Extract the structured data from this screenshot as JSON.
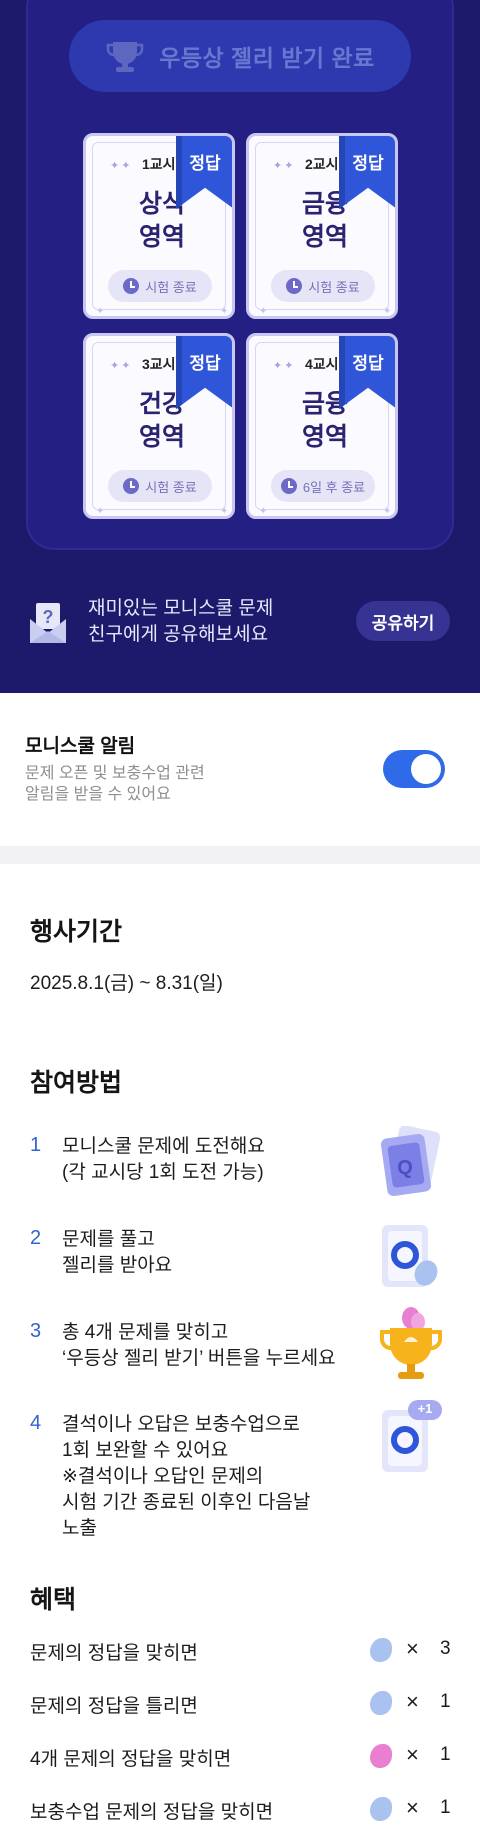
{
  "award_button": {
    "label": "우등상 젤리 받기 완료",
    "icon": "trophy-icon"
  },
  "cards": [
    {
      "period": "1교시",
      "subject_line1": "상식",
      "subject_line2": "영역",
      "badge": "정답",
      "status": "시험 종료"
    },
    {
      "period": "2교시",
      "subject_line1": "금융",
      "subject_line2": "영역",
      "badge": "정답",
      "status": "시험 종료"
    },
    {
      "period": "3교시",
      "subject_line1": "건강",
      "subject_line2": "영역",
      "badge": "정답",
      "status": "시험 종료"
    },
    {
      "period": "4교시",
      "subject_line1": "금융",
      "subject_line2": "영역",
      "badge": "정답",
      "status": "6일 후 종료"
    }
  ],
  "share": {
    "line1": "재미있는 모니스쿨 문제",
    "line2": "친구에게 공유해보세요",
    "button": "공유하기"
  },
  "notification": {
    "title": "모니스쿨 알림",
    "desc_line1": "문제 오픈 및 보충수업 관련",
    "desc_line2": "알림을 받을 수 있어요",
    "toggle_on": true
  },
  "event_period": {
    "title": "행사기간",
    "value": "2025.8.1(금) ~ 8.31(일)"
  },
  "how_to": {
    "title": "참여방법",
    "steps": [
      {
        "num": "1",
        "line1": "모니스쿨 문제에 도전해요",
        "line2": "(각 교시당 1회 도전 가능)",
        "icon": "quiz-card-icon"
      },
      {
        "num": "2",
        "line1": "문제를 풀고",
        "line2": "젤리를 받아요",
        "icon": "answer-card-jelly-icon"
      },
      {
        "num": "3",
        "line1": "총 4개 문제를 맞히고",
        "line2": "‘우등상 젤리 받기’ 버튼을 누르세요",
        "icon": "trophy-jelly-icon"
      },
      {
        "num": "4",
        "line1": "결석이나 오답은 보충수업으로",
        "line2": "1회 보완할 수 있어요",
        "line3": "※결석이나 오답인 문제의",
        "line4": "시험 기간 종료된 이후인 다음날",
        "line5": "노출",
        "icon": "plus-one-card-icon",
        "badge": "+1"
      }
    ]
  },
  "benefits": {
    "title": "혜택",
    "items": [
      {
        "text": "문제의 정답을 맞히면",
        "jelly": "blue-jelly-icon",
        "times": "×",
        "count": "3"
      },
      {
        "text": "문제의 정답을 틀리면",
        "jelly": "blue-jelly-icon",
        "times": "×",
        "count": "1"
      },
      {
        "text": "4개 문제의 정답을 맞히면",
        "jelly": "pink-jelly-icon",
        "times": "×",
        "count": "1"
      },
      {
        "text": "보충수업 문제의 정답을 맞히면",
        "jelly": "blue-jelly-icon",
        "times": "×",
        "count": "1"
      }
    ]
  },
  "colors": {
    "navy_bg": "#1d1a6b",
    "accent_blue": "#2f55d8",
    "toggle_blue": "#2f6be8",
    "jelly_blue": "#a9c2ef",
    "jelly_pink": "#e87fd0"
  }
}
